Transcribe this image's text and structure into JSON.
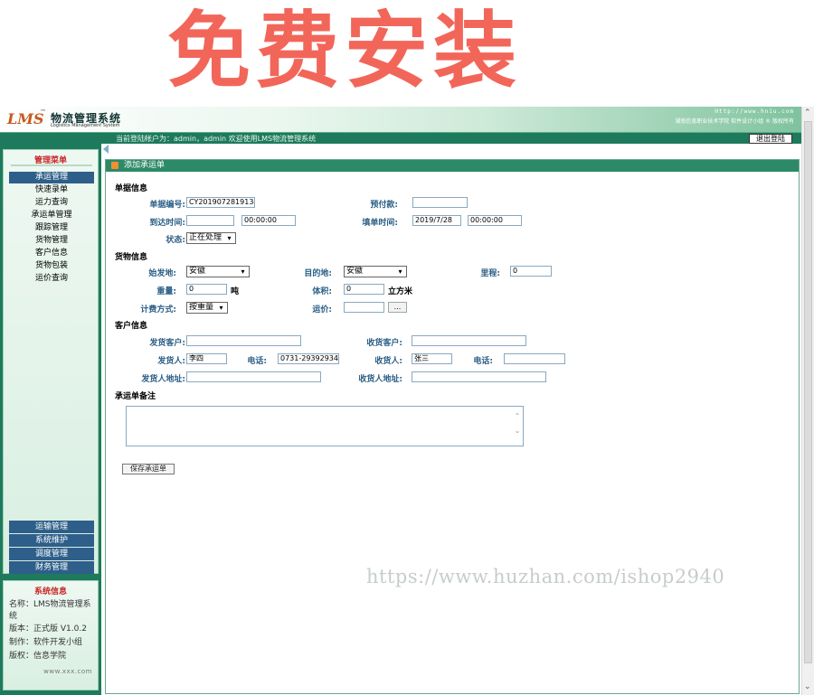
{
  "banner": {
    "text": "免费安装"
  },
  "header": {
    "logo": "LMS",
    "logo_tm": "™",
    "title_cn": "物流管理系统",
    "title_en": "Logistics Management System",
    "url": "Http://www.hniu.com",
    "credit": "湖南信息职业技术学院 软件设计小组 ® 版权所有"
  },
  "subbar": {
    "login_text": "当前登陆帐户为：admin，admin 欢迎使用LMS物流管理系统",
    "logout_label": "退出登陆"
  },
  "sidebar": {
    "menu_title": "管理菜单",
    "items": [
      {
        "label": "承运管理"
      },
      {
        "label": "快速录单"
      },
      {
        "label": "运力查询"
      },
      {
        "label": "承运单管理"
      },
      {
        "label": "跟踪管理"
      },
      {
        "label": "货物管理"
      },
      {
        "label": "客户信息"
      },
      {
        "label": "货物包装"
      },
      {
        "label": "运价查询"
      }
    ],
    "bottom_items": [
      {
        "label": "运输管理"
      },
      {
        "label": "系统维护"
      },
      {
        "label": "调度管理"
      },
      {
        "label": "财务管理"
      }
    ],
    "info_title": "系统信息",
    "info": {
      "name_line1": "名称：LMS物流管理系",
      "name_line2": "统",
      "version": "版本：正式版 V1.0.2",
      "maker": "制作：软件开发小组",
      "rights": "版权：信息学院",
      "url": "www.xxx.com"
    }
  },
  "content": {
    "title": "添加承运单",
    "sections": {
      "order": "单据信息",
      "goods": "货物信息",
      "customer": "客户信息",
      "remark": "承运单备注"
    },
    "labels": {
      "order_no": "单据编号:",
      "prepay": "预付款:",
      "arrive_time": "到达时间:",
      "fill_time": "填单时间:",
      "status": "状态:",
      "origin": "始发地:",
      "destination": "目的地:",
      "mileage": "里程:",
      "weight": "重量:",
      "volume": "体积:",
      "billing": "计费方式:",
      "freight": "运价:",
      "sender": "发货客户:",
      "receiver_cust": "收货客户:",
      "consignor": "发货人:",
      "phone1": "电话:",
      "consignee": "收货人:",
      "phone2": "电话:",
      "sender_addr": "发货人地址:",
      "receiver_addr": "收货人地址:"
    },
    "values": {
      "order_no": "CY20190728191341",
      "prepay": "",
      "arrive_date": "",
      "arrive_clock": "00:00:00",
      "fill_date": "2019/7/28",
      "fill_clock": "00:00:00",
      "status": "正在处理",
      "origin": "安徽",
      "destination": "安徽",
      "mileage": "0",
      "weight": "0",
      "weight_unit": "吨",
      "volume": "0",
      "volume_unit": "立方米",
      "billing": "按重量",
      "freight": "",
      "freight_btn": "...",
      "sender": "",
      "receiver_cust": "",
      "consignor": "李四",
      "phone1": "0731-29392934",
      "consignee": "张三",
      "phone2": "",
      "sender_addr": "",
      "receiver_addr": "",
      "remark": ""
    },
    "save_label": "保存承运单"
  },
  "watermark": "https://www.huzhan.com/ishop2940",
  "icons": {
    "rss": "rss-icon",
    "collapse": "collapse-arrow-icon",
    "dropdown": "chevron-down-icon"
  },
  "colors": {
    "primary": "#1e7a5c",
    "title_bar": "#2c8a68",
    "active_menu": "#2e5f8a",
    "banner": "#f2665a",
    "label": "#2b5e85"
  }
}
